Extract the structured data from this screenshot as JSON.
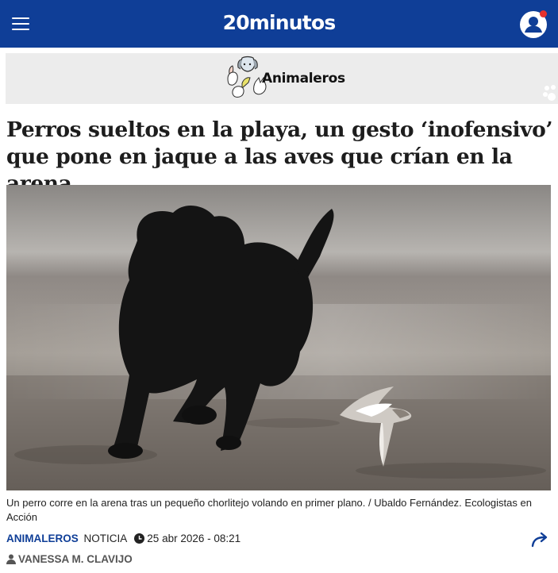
{
  "header": {
    "logo": "20minutos",
    "menu_icon": "hamburger-menu-icon",
    "user_icon": "user-account-icon",
    "notification_color": "#e5322d",
    "brand_color": "#0f3e97"
  },
  "section_banner": {
    "title": "Animaleros",
    "art": "animals-illustration"
  },
  "article": {
    "headline": "Perros sueltos en la playa, un gesto ‘inofensivo’ que pone en jaque a las aves que crían en la arena",
    "image": "dog-running-on-beach-with-plover-bird",
    "caption": "Un perro corre en la arena tras un pequeño chorlitejo volando en primer plano. / Ubaldo Fernández. Ecologistas en Acción",
    "section": "ANIMALEROS",
    "type": "NOTICIA",
    "date": "25 abr 2026 - 08:21",
    "author": "VANESSA M. CLAVIJO",
    "share_icon": "share-arrow-icon"
  }
}
